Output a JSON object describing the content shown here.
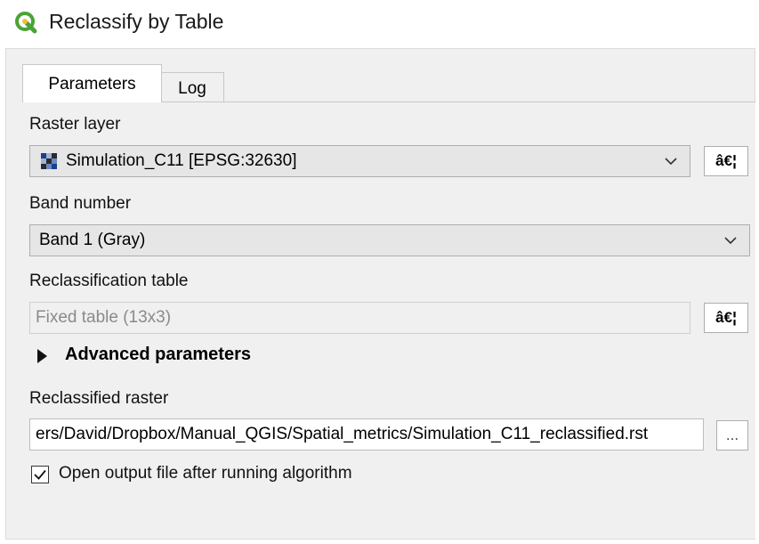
{
  "window": {
    "title": "Reclassify by Table",
    "icon": "qgis-icon"
  },
  "tabs": [
    {
      "label": "Parameters"
    },
    {
      "label": "Log"
    }
  ],
  "raster_layer": {
    "label": "Raster layer",
    "value": "Simulation_C11 [EPSG:32630]",
    "browse_label": "â€¦"
  },
  "band_number": {
    "label": "Band number",
    "value": "Band 1 (Gray)"
  },
  "reclass_table": {
    "label": "Reclassification table",
    "value": "Fixed table (13x3)",
    "browse_label": "â€¦"
  },
  "advanced": {
    "label": "Advanced parameters"
  },
  "output": {
    "label": "Reclassified raster",
    "value": "ers/David/Dropbox/Manual_QGIS/Spatial_metrics/Simulation_C11_reclassified.rst",
    "browse_label": "..."
  },
  "open_output": {
    "label": "Open output file after running algorithm",
    "checked": true
  },
  "colors": {
    "accent_green": "#4aa338"
  }
}
